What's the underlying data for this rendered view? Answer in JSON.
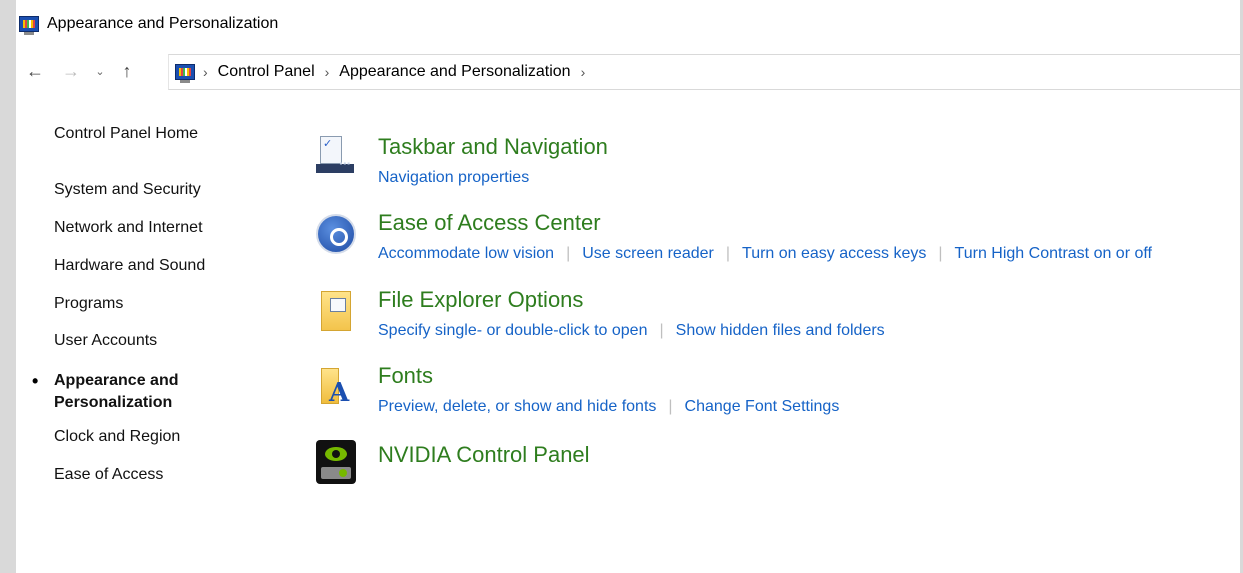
{
  "window": {
    "title": "Appearance and Personalization",
    "icon": "control-panel-icon"
  },
  "nav": {
    "back_glyph": "←",
    "forward_glyph": "→",
    "recent_glyph": "⌄",
    "up_glyph": "↑"
  },
  "address": {
    "separator": "›",
    "crumbs": [
      "Control Panel",
      "Appearance and Personalization"
    ]
  },
  "sidebar": {
    "items": [
      {
        "label": "Control Panel Home",
        "current": false
      },
      {
        "label": "System and Security",
        "current": false
      },
      {
        "label": "Network and Internet",
        "current": false
      },
      {
        "label": "Hardware and Sound",
        "current": false
      },
      {
        "label": "Programs",
        "current": false
      },
      {
        "label": "User Accounts",
        "current": false
      },
      {
        "label_line1": "Appearance and",
        "label_line2": "Personalization",
        "current": true
      },
      {
        "label": "Clock and Region",
        "current": false
      },
      {
        "label": "Ease of Access",
        "current": false
      }
    ],
    "bullet": "•"
  },
  "categories": [
    {
      "title": "Taskbar and Navigation",
      "icon": "taskbar-icon",
      "links": [
        "Navigation properties"
      ]
    },
    {
      "title": "Ease of Access Center",
      "icon": "ease-of-access-icon",
      "links": [
        "Accommodate low vision",
        "Use screen reader",
        "Turn on easy access keys",
        "Turn High Contrast on or off"
      ]
    },
    {
      "title": "File Explorer Options",
      "icon": "file-explorer-options-icon",
      "links": [
        "Specify single- or double-click to open",
        "Show hidden files and folders"
      ]
    },
    {
      "title": "Fonts",
      "icon": "fonts-icon",
      "links": [
        "Preview, delete, or show and hide fonts",
        "Change Font Settings"
      ]
    },
    {
      "title": "NVIDIA Control Panel",
      "icon": "nvidia-icon",
      "links": []
    }
  ],
  "colors": {
    "category_title": "#2e7d1e",
    "link": "#1663c7",
    "link_separator": "#bfbfbf"
  }
}
